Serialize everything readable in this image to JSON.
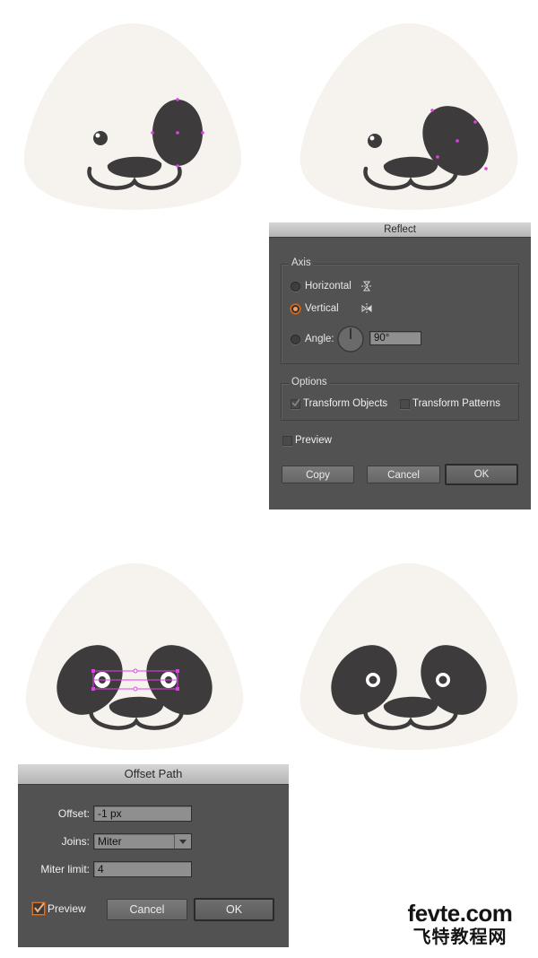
{
  "reflect_dialog": {
    "title": "Reflect",
    "axis_group_label": "Axis",
    "horizontal_label": "Horizontal",
    "vertical_label": "Vertical",
    "angle_label": "Angle:",
    "angle_value": "90°",
    "selected_axis": "Vertical",
    "options_group_label": "Options",
    "transform_objects_label": "Transform Objects",
    "transform_patterns_label": "Transform Patterns",
    "preview_label": "Preview",
    "copy_label": "Copy",
    "cancel_label": "Cancel",
    "ok_label": "OK"
  },
  "offset_dialog": {
    "title": "Offset Path",
    "offset_label": "Offset:",
    "offset_value": "-1 px",
    "joins_label": "Joins:",
    "joins_value": "Miter",
    "miter_label": "Miter limit:",
    "miter_value": "4",
    "preview_label": "Preview",
    "preview_checked": true,
    "cancel_label": "Cancel",
    "ok_label": "OK"
  },
  "watermark": {
    "line1": "fevte.com",
    "line2": "飞特教程网"
  },
  "colors": {
    "face": "#f6f3ee",
    "dark": "#3e3b3c",
    "selection": "#e040e8",
    "dialog_bg": "#525252",
    "accent_orange": "#d4732a"
  }
}
